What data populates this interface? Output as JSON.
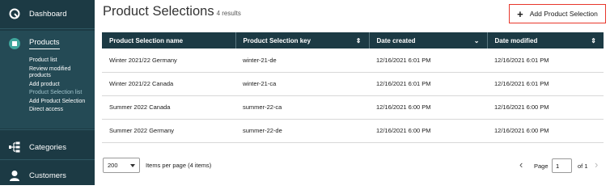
{
  "sidebar": {
    "dashboard": "Dashboard",
    "products": "Products",
    "product_items": [
      "Product list",
      "Review modified products",
      "Add product",
      "Product Selection list",
      "Add Product Selection",
      "Direct access"
    ],
    "active_item_index": 3,
    "categories": "Categories",
    "customers": "Customers"
  },
  "page": {
    "title": "Product Selections",
    "count": "4 results",
    "add_button": "Add Product Selection"
  },
  "table": {
    "columns": [
      "Product Selection name",
      "Product Selection key",
      "Date created",
      "Date modified"
    ],
    "rows": [
      [
        "Winter 2021/22 Germany",
        "winter-21-de",
        "12/16/2021 6:01 PM",
        "12/16/2021 6:01 PM"
      ],
      [
        "Winter 2021/22 Canada",
        "winter-21-ca",
        "12/16/2021 6:01 PM",
        "12/16/2021 6:01 PM"
      ],
      [
        "Summer 2022 Canada",
        "summer-22-ca",
        "12/16/2021 6:00 PM",
        "12/16/2021 6:00 PM"
      ],
      [
        "Summer 2022 Germany",
        "summer-22-de",
        "12/16/2021 6:00 PM",
        "12/16/2021 6:00 PM"
      ]
    ]
  },
  "pagination": {
    "per_page": "200",
    "per_page_label": "Items per page (4 items)",
    "page_label": "Page",
    "page_value": "1",
    "of_label": "of 1"
  },
  "colors": {
    "sidebar_bg": "#1c3a44",
    "header_bg": "#1c3a44",
    "highlight": "#e8372c"
  }
}
